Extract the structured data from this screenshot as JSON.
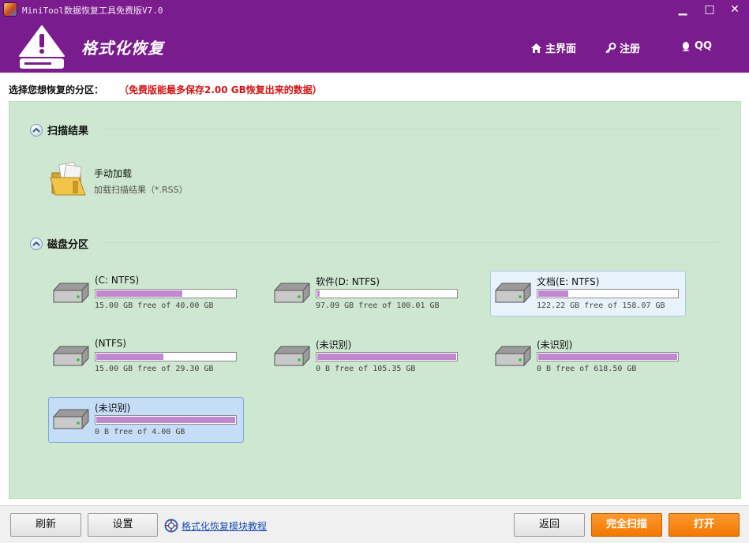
{
  "window": {
    "title": "MiniTool数据恢复工具免费版V7.0",
    "controls": {
      "minimize": "▁",
      "maximize": "□",
      "close": "✕"
    }
  },
  "header": {
    "title": "格式化恢复",
    "nav": [
      {
        "label": "主界面",
        "icon": "home-icon"
      },
      {
        "label": "注册",
        "icon": "key-icon"
      },
      {
        "label": "QQ",
        "icon": "qq-icon"
      }
    ]
  },
  "prompt": {
    "label": "选择您想恢复的分区：",
    "note": "（免费版能最多保存2.00 GB恢复出来的数据）"
  },
  "scan_results": {
    "title": "扫描结果",
    "manual_load": {
      "title": "手动加载",
      "subtitle": "加载扫描结果（*.RSS）",
      "icon": "folder-icon"
    }
  },
  "partitions": {
    "title": "磁盘分区",
    "items": [
      {
        "label": "(C: NTFS)",
        "free": "15.00 GB free of 40.00 GB",
        "used_fraction": 0.625,
        "state": "normal"
      },
      {
        "label": "软件(D: NTFS)",
        "free": "97.09 GB free of 100.01 GB",
        "used_fraction": 0.03,
        "state": "normal"
      },
      {
        "label": "文档(E: NTFS)",
        "free": "122.22 GB free of 158.07 GB",
        "used_fraction": 0.227,
        "state": "highlight"
      },
      {
        "label": "(NTFS)",
        "free": "15.00 GB free of 29.30 GB",
        "used_fraction": 0.488,
        "state": "normal"
      },
      {
        "label": "(未识别)",
        "free": "0 B free of 105.35 GB",
        "used_fraction": 1.0,
        "state": "normal"
      },
      {
        "label": "(未识别)",
        "free": "0 B free of 618.50 GB",
        "used_fraction": 1.0,
        "state": "normal"
      },
      {
        "label": "(未识别)",
        "free": "0 B free of 4.00 GB",
        "used_fraction": 1.0,
        "state": "selected"
      }
    ]
  },
  "footer": {
    "refresh": "刷新",
    "settings": "设置",
    "help_link": "格式化恢复模块教程",
    "back": "返回",
    "full_scan": "完全扫描",
    "open": "打开"
  },
  "colors": {
    "brand": "#7a1c8e",
    "panel": "#cde7d0",
    "usage": "#c088cf",
    "note": "#d41414",
    "action": "#f07800"
  }
}
